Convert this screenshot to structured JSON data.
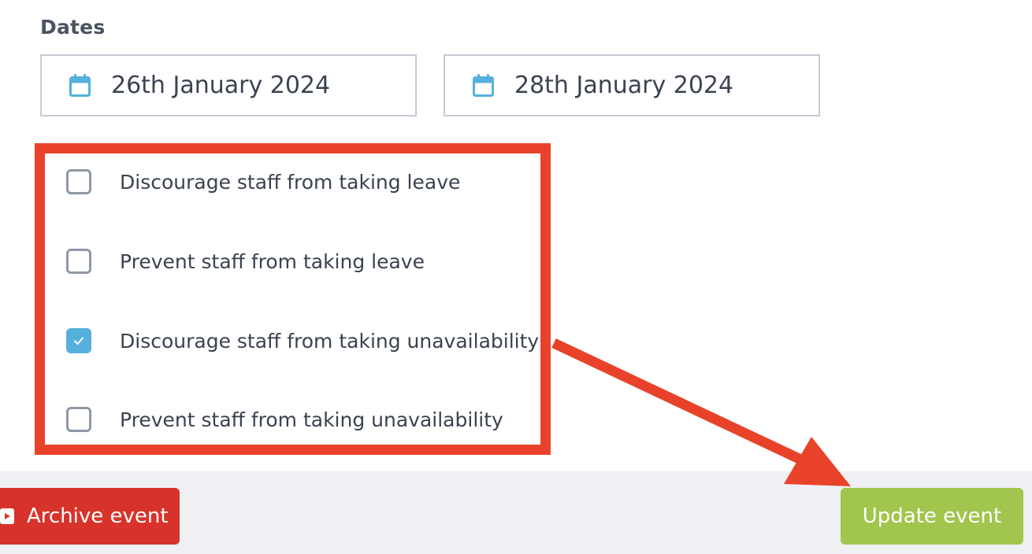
{
  "dates": {
    "label": "Dates",
    "start_date": "26th January 2024",
    "end_date": "28th January 2024",
    "icon": "calendar-icon"
  },
  "options": [
    {
      "label": "Discourage staff from taking leave",
      "checked": false
    },
    {
      "label": "Prevent staff from taking leave",
      "checked": false
    },
    {
      "label": "Discourage staff from taking unavailability",
      "checked": true
    },
    {
      "label": "Prevent staff from taking unavailability",
      "checked": false
    }
  ],
  "footer": {
    "archive_label": "Archive event",
    "update_label": "Update event"
  },
  "colors": {
    "annotation": "#e8432a",
    "archive_button": "#d8332a",
    "update_button": "#a1c54d",
    "checkbox_checked": "#56b0dc",
    "calendar_icon": "#56b0dc"
  }
}
